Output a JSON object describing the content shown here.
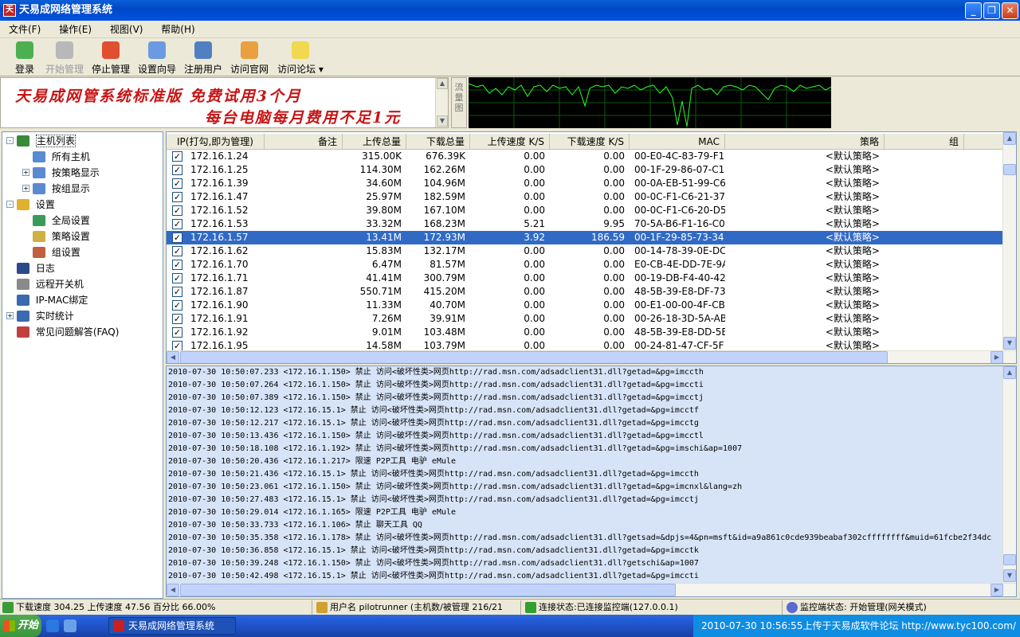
{
  "window": {
    "title": "天易成网络管理系统",
    "app_icon_text": "天"
  },
  "menu": [
    {
      "label": "文件(F)"
    },
    {
      "label": "操作(E)"
    },
    {
      "label": "视图(V)"
    },
    {
      "label": "帮助(H)"
    }
  ],
  "toolbar": [
    {
      "label": "登录",
      "icon": "login-icon",
      "color": "#4caf50",
      "disabled": false
    },
    {
      "label": "开始管理",
      "icon": "start-icon",
      "color": "#b8b8b8",
      "disabled": true
    },
    {
      "label": "停止管理",
      "icon": "stop-icon",
      "color": "#e05030",
      "disabled": false
    },
    {
      "label": "设置向导",
      "icon": "wizard-icon",
      "color": "#6a9be0",
      "disabled": false
    },
    {
      "label": "注册用户",
      "icon": "user-icon",
      "color": "#5080c0",
      "disabled": false
    },
    {
      "label": "访问官网",
      "icon": "home-icon",
      "color": "#e8a040",
      "disabled": false
    },
    {
      "label": "访问论坛",
      "icon": "forum-icon",
      "color": "#f0d850",
      "disabled": false
    }
  ],
  "banner": {
    "line1": "天易成网管系统标准版  免费试用3个月",
    "line2": "每台电脑每月费用不足1元"
  },
  "flow_label": "流量图",
  "tree": [
    {
      "label": "主机列表",
      "icon": "globe-icon",
      "color": "#3a8a3a",
      "level": 0,
      "toggle": "-",
      "selected": true
    },
    {
      "label": "所有主机",
      "icon": "computer-icon",
      "color": "#5a8ad0",
      "level": 1,
      "toggle": "",
      "selected": false
    },
    {
      "label": "按策略显示",
      "icon": "computer-icon",
      "color": "#5a8ad0",
      "level": 1,
      "toggle": "+",
      "selected": false
    },
    {
      "label": "按组显示",
      "icon": "computer-icon",
      "color": "#5a8ad0",
      "level": 1,
      "toggle": "+",
      "selected": false
    },
    {
      "label": "设置",
      "icon": "settings-icon",
      "color": "#e0b030",
      "level": 0,
      "toggle": "-",
      "selected": false
    },
    {
      "label": "全局设置",
      "icon": "globe-settings-icon",
      "color": "#3a9a5a",
      "level": 1,
      "toggle": "",
      "selected": false
    },
    {
      "label": "策略设置",
      "icon": "policy-icon",
      "color": "#d0b040",
      "level": 1,
      "toggle": "",
      "selected": false
    },
    {
      "label": "组设置",
      "icon": "group-icon",
      "color": "#c06040",
      "level": 1,
      "toggle": "",
      "selected": false
    },
    {
      "label": "日志",
      "icon": "log-icon",
      "color": "#2a4a8a",
      "level": 0,
      "toggle": "",
      "selected": false
    },
    {
      "label": "远程开关机",
      "icon": "remote-icon",
      "color": "#8a8a8a",
      "level": 0,
      "toggle": "",
      "selected": false
    },
    {
      "label": "IP-MAC绑定",
      "icon": "ipmac-icon",
      "color": "#3a6ab0",
      "level": 0,
      "toggle": "",
      "selected": false
    },
    {
      "label": "实时统计",
      "icon": "stats-icon",
      "color": "#3a6ab0",
      "level": 0,
      "toggle": "+",
      "selected": false
    },
    {
      "label": "常见问题解答(FAQ)",
      "icon": "faq-icon",
      "color": "#c04040",
      "level": 0,
      "toggle": "",
      "selected": false
    }
  ],
  "table": {
    "columns": [
      "IP(打勾,即为管理)",
      "备注",
      "上传总量",
      "下载总量",
      "上传速度 K/S",
      "下载速度 K/S",
      "MAC",
      "策略",
      "组"
    ],
    "rows": [
      {
        "ip": "172.16.1.24",
        "note": "",
        "up_total": "315.00K",
        "down_total": "676.39K",
        "up_speed": "0.00",
        "down_speed": "0.00",
        "mac": "00-E0-4C-83-79-F1",
        "policy": "<默认策略>",
        "group": "",
        "checked": true,
        "selected": false
      },
      {
        "ip": "172.16.1.25",
        "note": "",
        "up_total": "114.30M",
        "down_total": "162.26M",
        "up_speed": "0.00",
        "down_speed": "0.00",
        "mac": "00-1F-29-86-07-C1",
        "policy": "<默认策略>",
        "group": "",
        "checked": true,
        "selected": false
      },
      {
        "ip": "172.16.1.39",
        "note": "",
        "up_total": "34.60M",
        "down_total": "104.96M",
        "up_speed": "0.00",
        "down_speed": "0.00",
        "mac": "00-0A-EB-51-99-C6",
        "policy": "<默认策略>",
        "group": "",
        "checked": true,
        "selected": false
      },
      {
        "ip": "172.16.1.47",
        "note": "",
        "up_total": "25.97M",
        "down_total": "182.59M",
        "up_speed": "0.00",
        "down_speed": "0.00",
        "mac": "00-0C-F1-C6-21-37",
        "policy": "<默认策略>",
        "group": "",
        "checked": true,
        "selected": false
      },
      {
        "ip": "172.16.1.52",
        "note": "",
        "up_total": "39.80M",
        "down_total": "167.10M",
        "up_speed": "0.00",
        "down_speed": "0.00",
        "mac": "00-0C-F1-C6-20-D5",
        "policy": "<默认策略>",
        "group": "",
        "checked": true,
        "selected": false
      },
      {
        "ip": "172.16.1.53",
        "note": "",
        "up_total": "33.32M",
        "down_total": "168.23M",
        "up_speed": "5.21",
        "down_speed": "9.95",
        "mac": "70-5A-B6-F1-16-C0",
        "policy": "<默认策略>",
        "group": "",
        "checked": true,
        "selected": false
      },
      {
        "ip": "172.16.1.57",
        "note": "",
        "up_total": "13.41M",
        "down_total": "172.93M",
        "up_speed": "3.92",
        "down_speed": "186.59",
        "mac": "00-1F-29-85-73-34",
        "policy": "<默认策略>",
        "group": "",
        "checked": true,
        "selected": true
      },
      {
        "ip": "172.16.1.62",
        "note": "",
        "up_total": "15.83M",
        "down_total": "132.17M",
        "up_speed": "0.00",
        "down_speed": "0.00",
        "mac": "00-14-78-39-0E-DC",
        "policy": "<默认策略>",
        "group": "",
        "checked": true,
        "selected": false
      },
      {
        "ip": "172.16.1.70",
        "note": "",
        "up_total": "6.47M",
        "down_total": "81.57M",
        "up_speed": "0.00",
        "down_speed": "0.00",
        "mac": "E0-CB-4E-DD-7E-9A",
        "policy": "<默认策略>",
        "group": "",
        "checked": true,
        "selected": false
      },
      {
        "ip": "172.16.1.71",
        "note": "",
        "up_total": "41.41M",
        "down_total": "300.79M",
        "up_speed": "0.00",
        "down_speed": "0.00",
        "mac": "00-19-DB-F4-40-42",
        "policy": "<默认策略>",
        "group": "",
        "checked": true,
        "selected": false
      },
      {
        "ip": "172.16.1.87",
        "note": "",
        "up_total": "550.71M",
        "down_total": "415.20M",
        "up_speed": "0.00",
        "down_speed": "0.00",
        "mac": "48-5B-39-E8-DF-73",
        "policy": "<默认策略>",
        "group": "",
        "checked": true,
        "selected": false
      },
      {
        "ip": "172.16.1.90",
        "note": "",
        "up_total": "11.33M",
        "down_total": "40.70M",
        "up_speed": "0.00",
        "down_speed": "0.00",
        "mac": "00-E1-00-00-4F-CB",
        "policy": "<默认策略>",
        "group": "",
        "checked": true,
        "selected": false
      },
      {
        "ip": "172.16.1.91",
        "note": "",
        "up_total": "7.26M",
        "down_total": "39.91M",
        "up_speed": "0.00",
        "down_speed": "0.00",
        "mac": "00-26-18-3D-5A-AB",
        "policy": "<默认策略>",
        "group": "",
        "checked": true,
        "selected": false
      },
      {
        "ip": "172.16.1.92",
        "note": "",
        "up_total": "9.01M",
        "down_total": "103.48M",
        "up_speed": "0.00",
        "down_speed": "0.00",
        "mac": "48-5B-39-E8-DD-5E",
        "policy": "<默认策略>",
        "group": "",
        "checked": true,
        "selected": false
      },
      {
        "ip": "172.16.1.95",
        "note": "",
        "up_total": "14.58M",
        "down_total": "103.79M",
        "up_speed": "0.00",
        "down_speed": "0.00",
        "mac": "00-24-81-47-CF-5F",
        "policy": "<默认策略>",
        "group": "",
        "checked": true,
        "selected": false
      }
    ]
  },
  "log": [
    "2010-07-30 10:50:07.233 <172.16.1.150> 禁止 访问<破坏性类>网页http://rad.msn.com/adsadclient31.dll?getad=&pg=imccth",
    "2010-07-30 10:50:07.264 <172.16.1.150> 禁止 访问<破坏性类>网页http://rad.msn.com/adsadclient31.dll?getad=&pg=imccti",
    "2010-07-30 10:50:07.389 <172.16.1.150> 禁止 访问<破坏性类>网页http://rad.msn.com/adsadclient31.dll?getad=&pg=imcctj",
    "2010-07-30 10:50:12.123 <172.16.15.1> 禁止 访问<破坏性类>网页http://rad.msn.com/adsadclient31.dll?getad=&pg=imcctf",
    "2010-07-30 10:50:12.217 <172.16.15.1> 禁止 访问<破坏性类>网页http://rad.msn.com/adsadclient31.dll?getad=&pg=imcctg",
    "2010-07-30 10:50:13.436 <172.16.1.150> 禁止 访问<破坏性类>网页http://rad.msn.com/adsadclient31.dll?getad=&pg=imcctl",
    "2010-07-30 10:50:18.108 <172.16.1.192> 禁止 访问<破坏性类>网页http://rad.msn.com/adsadclient31.dll?getad=&pg=imschi&ap=1007",
    "2010-07-30 10:50:20.436 <172.16.1.217> 限速 P2P工具 电驴 eMule",
    "2010-07-30 10:50:21.436 <172.16.15.1> 禁止 访问<破坏性类>网页http://rad.msn.com/adsadclient31.dll?getad=&pg=imccth",
    "2010-07-30 10:50:23.061 <172.16.1.150> 禁止 访问<破坏性类>网页http://rad.msn.com/adsadclient31.dll?getad=&pg=imcnxl&lang=zh",
    "2010-07-30 10:50:27.483 <172.16.15.1> 禁止 访问<破坏性类>网页http://rad.msn.com/adsadclient31.dll?getad=&pg=imcctj",
    "2010-07-30 10:50:29.014 <172.16.1.165> 限速 P2P工具 电驴 eMule",
    "2010-07-30 10:50:33.733 <172.16.1.106> 禁止 聊天工具 QQ",
    "2010-07-30 10:50:35.358 <172.16.1.178> 禁止 访问<破坏性类>网页http://rad.msn.com/adsadclient31.dll?getsad=&dpjs=4&pn=msft&id=a9a861c0cde939beabaf302cffffffff&muid=61fcbe2f34dc",
    "2010-07-30 10:50:36.858 <172.16.15.1> 禁止 访问<破坏性类>网页http://rad.msn.com/adsadclient31.dll?getad=&pg=imcctk",
    "2010-07-30 10:50:39.248 <172.16.1.150> 禁止 访问<破坏性类>网页http://rad.msn.com/adsadclient31.dll?getschi&ap=1007",
    "2010-07-30 10:50:42.498 <172.16.15.1> 禁止 访问<破坏性类>网页http://rad.msn.com/adsadclient31.dll?getad=&pg=imccti"
  ],
  "status": {
    "speed": "下载速度 304.25 上传速度 47.56 百分比 66.00%",
    "user": "用户名 pilotrunner (主机数/被管理 216/21",
    "conn": "连接状态:已连接监控端(127.0.0.1)",
    "monitor": "监控端状态: 开始管理(网关模式)"
  },
  "taskbar": {
    "start": "开始",
    "task": "天易成网络管理系统",
    "tray": "2010-07-30 10:56:55上传于天易成软件论坛 http://www.tyc100.com/"
  }
}
